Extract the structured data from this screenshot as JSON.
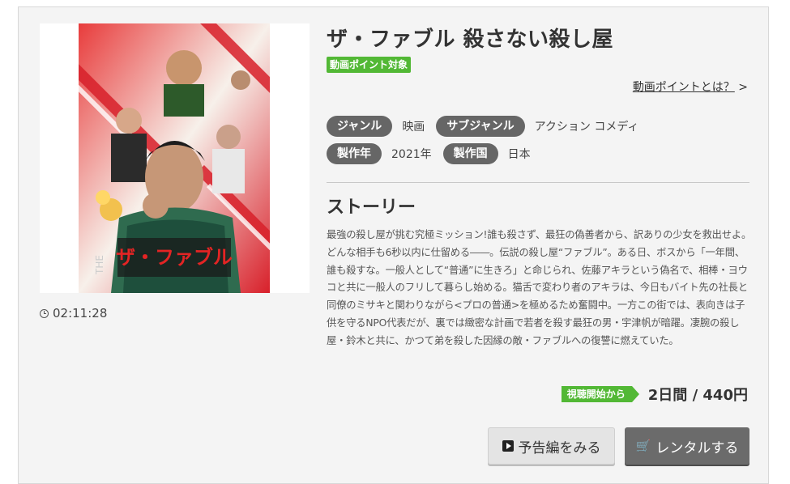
{
  "movie": {
    "title": "ザ・ファブル 殺さない殺し屋",
    "duration": "02:11:28",
    "point_badge": "動画ポイント対象",
    "point_link": "動画ポイントとは？",
    "point_link_arrow": ">",
    "poster_logo_text": "ザ・ファブル",
    "poster_side_text": "THE"
  },
  "meta": {
    "genre_label": "ジャンル",
    "genre_value": "映画",
    "subgenre_label": "サブジャンル",
    "subgenre_value": "アクション コメディ",
    "year_label": "製作年",
    "year_value": "2021年",
    "country_label": "製作国",
    "country_value": "日本"
  },
  "story": {
    "heading": "ストーリー",
    "text": "最強の殺し屋が挑む究極ミッション!誰も殺さず、最狂の偽善者から、訳ありの少女を救出せよ。どんな相手も6秒以内に仕留める――。伝説の殺し屋“ファブル”。ある日、ボスから「一年間、誰も殺すな。一般人として“普通”に生きろ」と命じられ、佐藤アキラという偽名で、相棒・ヨウコと共に一般人のフリして暮らし始める。猫舌で変わり者のアキラは、今日もバイト先の社長と同僚のミサキと関わりながら<プロの普通>を極めるため奮闘中。一方この街では、表向きは子供を守るNPO代表だが、裏では緻密な計画で若者を殺す最狂の男・宇津帆が暗躍。凄腕の殺し屋・鈴木と共に、かつて弟を殺した因縁の敵・ファブルへの復讐に燃えていた。"
  },
  "pricing": {
    "start_badge": "視聴開始から",
    "price": "2日間 / 440円"
  },
  "buttons": {
    "trailer": "予告編をみる",
    "rent": "レンタルする",
    "rent_icon_glyph": "🛒"
  },
  "colors": {
    "accent_green": "#52b835",
    "pill_gray": "#666666",
    "rent_button": "#6b6b6b"
  }
}
